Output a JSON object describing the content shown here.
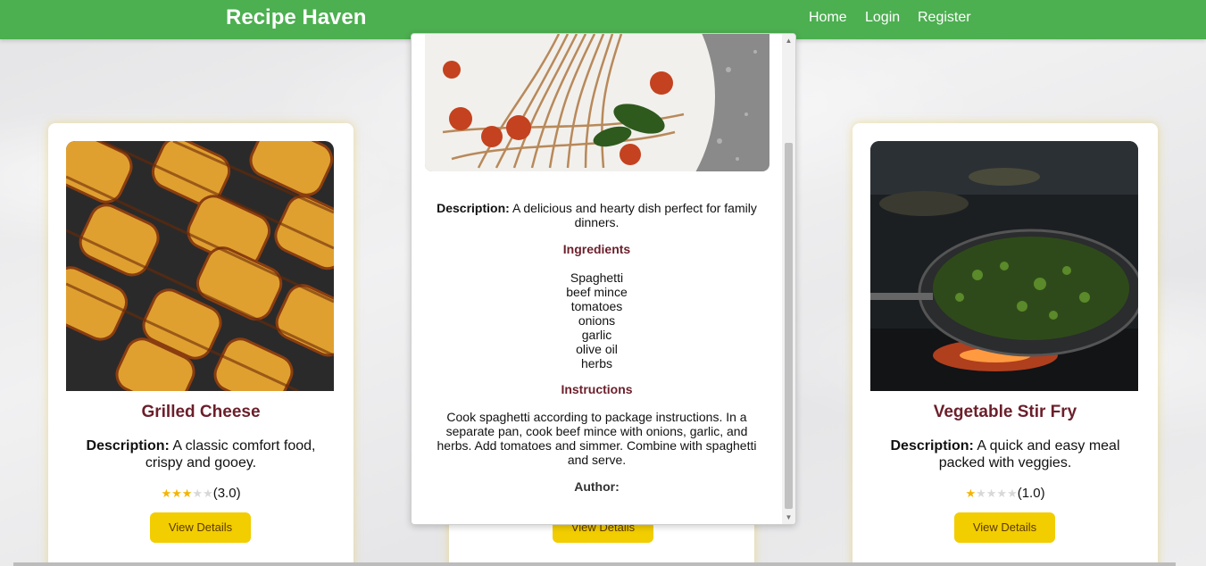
{
  "navbar": {
    "brand": "Recipe Haven",
    "links": [
      "Home",
      "Login",
      "Register"
    ],
    "color": "#4caf50"
  },
  "cards": [
    {
      "title": "Grilled Cheese",
      "desc_label": "Description:",
      "desc_text": "A classic comfort food, crispy and gooey.",
      "rating": 3,
      "rating_text": "(3.0)",
      "button": "View Details"
    },
    {
      "title": "Vegetable Stir Fry",
      "desc_label": "Description:",
      "desc_text": "A quick and easy meal packed with veggies.",
      "rating": 1,
      "rating_text": "(1.0)",
      "button": "View Details"
    }
  ],
  "middle_card": {
    "button": "View Details"
  },
  "modal": {
    "desc_label": "Description:",
    "desc_text": "A delicious and hearty dish perfect for family dinners.",
    "ingredients_heading": "Ingredients",
    "ingredients": [
      "Spaghetti",
      "beef mince",
      "tomatoes",
      "onions",
      "garlic",
      "olive oil",
      "herbs"
    ],
    "instructions_heading": "Instructions",
    "instructions": "Cook spaghetti according to package instructions. In a separate pan, cook beef mince with onions, garlic, and herbs. Add tomatoes and simmer. Combine with spaghetti and serve.",
    "author_label": "Author:"
  },
  "colors": {
    "accent": "#f2cd00",
    "title": "#6b1f2a",
    "star": "#f4b400"
  }
}
